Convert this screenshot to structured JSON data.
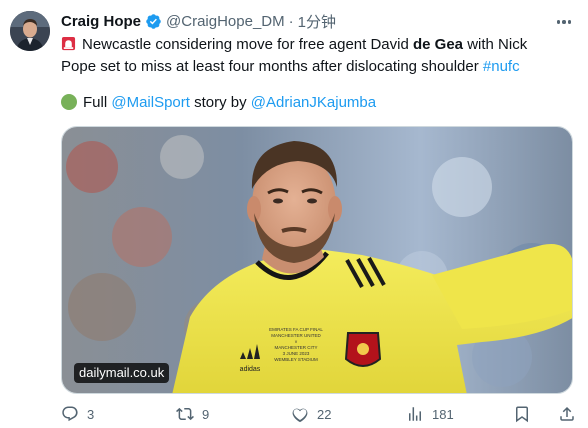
{
  "tweet": {
    "author_name": "Craig Hope",
    "handle": "@CraigHope_DM",
    "separator": "·",
    "time": "1分钟",
    "text": {
      "line1_a": "Newcastle considering move for free agent David ",
      "line1_bold": "de Gea",
      "line1_b": " with Nick",
      "line2_a": "Pope set to miss at least four months after dislocating shoulder ",
      "line2_tag": "#nufc",
      "line3_a": "Full ",
      "line3_mention1": "@MailSport",
      "line3_b": " story by ",
      "line3_mention2": "@AdrianJKajumba"
    },
    "emoji": {
      "line1": "siren-emoji",
      "line3": "green-circle-emoji"
    },
    "media": {
      "source_label": "dailymail.co.uk",
      "kit_brand": "adidas",
      "shirt_print": [
        "EMIRATES FA CUP FINAL",
        "MANCHESTER UNITED",
        "v",
        "MANCHESTER CITY",
        "3 JUNE 2023",
        "WEMBLEY STADIUM"
      ]
    },
    "actions": {
      "replies": "3",
      "retweets": "9",
      "likes": "22",
      "views": "181"
    }
  },
  "colors": {
    "text": "#0f1419",
    "secondary": "#536471",
    "link": "#1d9bf0",
    "verified": "#1d9bf0",
    "jersey": "#efe544"
  }
}
